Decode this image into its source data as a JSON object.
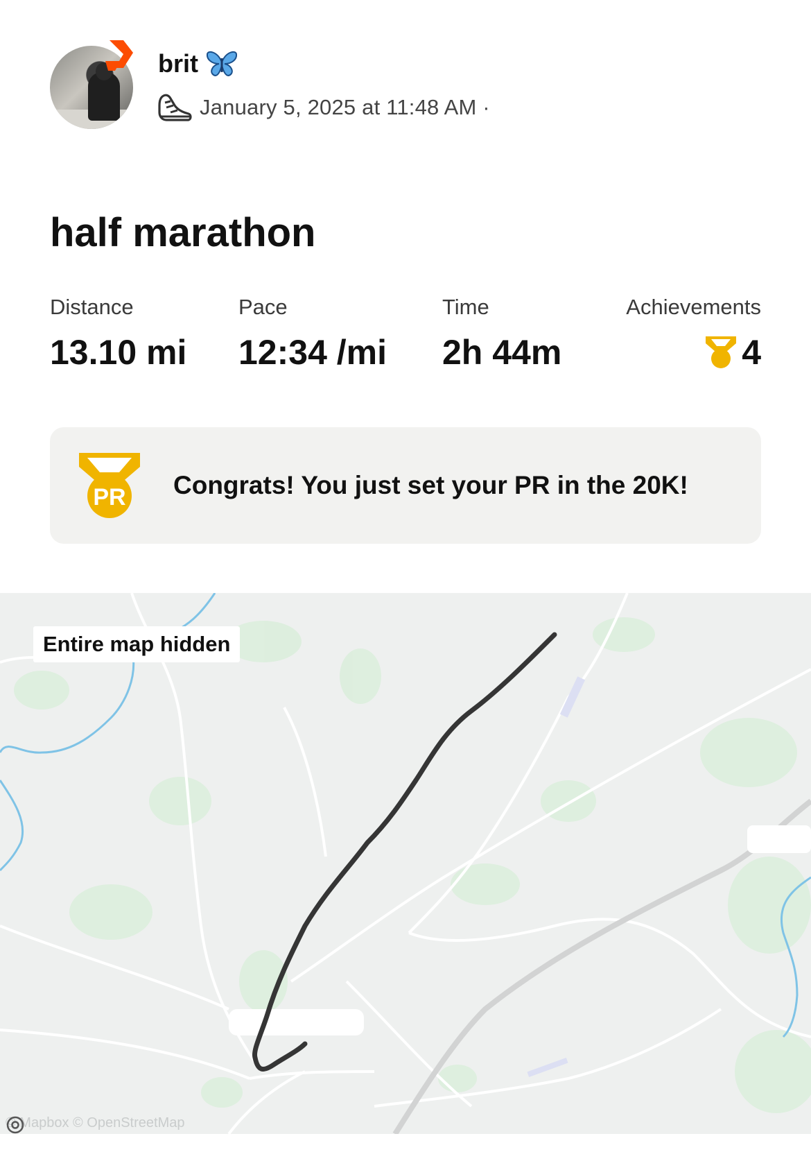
{
  "user": {
    "name": "brit",
    "datetime": "January 5, 2025 at 11:48 AM ·",
    "icons": {
      "avatar": "profile-photo",
      "app_badge": "strava-icon",
      "emoji": "butterfly-icon",
      "activity": "running-shoe-icon"
    }
  },
  "activity": {
    "title": "half marathon",
    "stats": [
      {
        "label": "Distance",
        "value": "13.10 mi"
      },
      {
        "label": "Pace",
        "value": "12:34 /mi"
      },
      {
        "label": "Time",
        "value": "2h 44m"
      },
      {
        "label": "Achievements",
        "value": "4"
      }
    ]
  },
  "pr_banner": {
    "text": "Congrats! You just set your PR in the 20K!",
    "badge": "PR",
    "icon": "pr-medal-icon"
  },
  "map": {
    "overlay_label": "Entire map hidden",
    "attribution": "© Mapbox © OpenStreetMap"
  },
  "colors": {
    "medal_gold": "#f0b400",
    "strava_orange": "#fc4c02",
    "route": "#333333",
    "map_bg": "#eef0ef",
    "banner_bg": "#f2f2f0"
  }
}
